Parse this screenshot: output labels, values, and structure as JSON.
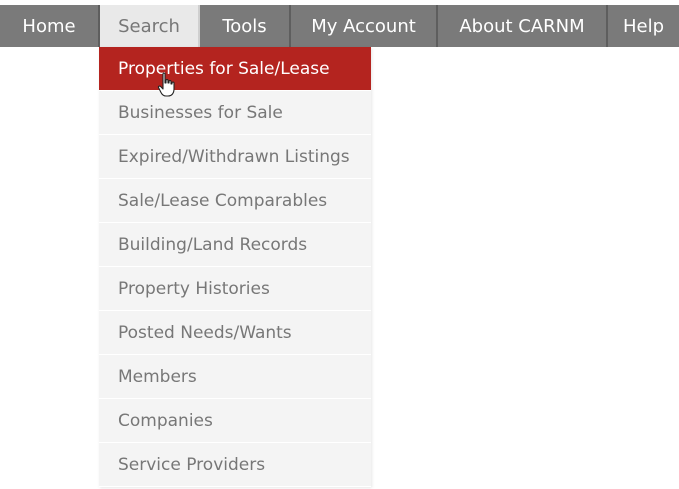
{
  "nav": {
    "items": [
      {
        "label": "Home"
      },
      {
        "label": "Search"
      },
      {
        "label": "Tools"
      },
      {
        "label": "My Account"
      },
      {
        "label": "About CARNM"
      },
      {
        "label": "Help"
      }
    ],
    "active_item": "Search"
  },
  "search_menu": {
    "highlighted_item": "Properties for Sale/Lease",
    "items": [
      {
        "label": "Properties for Sale/Lease"
      },
      {
        "label": "Businesses for Sale"
      },
      {
        "label": "Expired/Withdrawn Listings"
      },
      {
        "label": "Sale/Lease Comparables"
      },
      {
        "label": "Building/Land Records"
      },
      {
        "label": "Property Histories"
      },
      {
        "label": "Posted Needs/Wants"
      },
      {
        "label": "Members"
      },
      {
        "label": "Companies"
      },
      {
        "label": "Service Providers"
      }
    ]
  },
  "colors": {
    "nav_background": "#7a7a7a",
    "active_tab_background": "#e9e9e9",
    "highlight": "#b4241f",
    "menu_background": "#f4f4f4",
    "menu_text": "#777777"
  },
  "icons": {
    "cursor": "hand-pointer-icon"
  }
}
